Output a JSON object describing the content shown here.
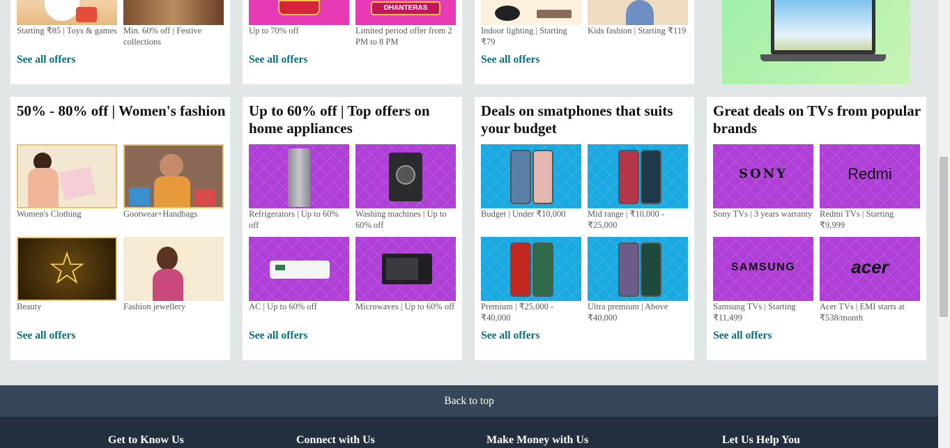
{
  "top_row": {
    "card1": {
      "tiles": [
        {
          "caption": "Starting ₹85 | Toys & games"
        },
        {
          "caption": "Min. 60% off | Festive collections"
        }
      ],
      "see_all": "See all offers"
    },
    "card2": {
      "tiles": [
        {
          "caption": "Up to 70% off"
        },
        {
          "caption": "Limited period offer from 2 PM to 8 PM",
          "banner_text": "DHANTERAS"
        }
      ],
      "see_all": "See all offers"
    },
    "card3": {
      "tiles": [
        {
          "caption": "Indoor lighting | Starting ₹79"
        },
        {
          "caption": "Kids fashion | Starting ₹119"
        }
      ],
      "see_all": "See all offers"
    }
  },
  "cards": [
    {
      "title": "50% - 80% off | Women's fashion",
      "tiles": [
        {
          "caption": "Women's Clothing"
        },
        {
          "caption": "Gootwear+Handbags"
        },
        {
          "caption": "Beauty"
        },
        {
          "caption": "Fashion jewellery"
        }
      ],
      "see_all": "See all offers"
    },
    {
      "title": "Up to 60% off | Top offers on home appliances",
      "tiles": [
        {
          "caption": "Refrigerators | Up to 60% off"
        },
        {
          "caption": "Washing machines | Up to 60% off"
        },
        {
          "caption": "AC | Up to 60% off"
        },
        {
          "caption": "Microwaves | Up to 60% off"
        }
      ],
      "see_all": "See all offers"
    },
    {
      "title": "Deals on smatphones that suits your budget",
      "tiles": [
        {
          "caption": "Budget | Under ₹10,000"
        },
        {
          "caption": "Mid range | ₹10,000 - ₹25,000"
        },
        {
          "caption": "Premium | ₹25,000 - ₹40,000"
        },
        {
          "caption": "Ultra premium | Above ₹40,000"
        }
      ],
      "see_all": "See all offers"
    },
    {
      "title": "Great deals on TVs from popular brands",
      "tiles": [
        {
          "caption": "Sony TVs | 3 years warranty",
          "brand": "SONY"
        },
        {
          "caption": "Redmi TVs | Starting ₹9,999",
          "brand": "Redmi"
        },
        {
          "caption": "Samsung TVs | Starting ₹11,499",
          "brand": "SAMSUNG"
        },
        {
          "caption": "Acer TVs | EMI starts at ₹538/month",
          "brand": "acer"
        }
      ],
      "see_all": "See all offers"
    }
  ],
  "back_to_top": "Back to top",
  "footer": {
    "columns": [
      "Get to Know Us",
      "Connect with Us",
      "Make Money with Us",
      "Let Us Help You"
    ]
  },
  "colors": {
    "link": "#007185",
    "back_to_top_bg": "#37475a",
    "footer_bg": "#232f3e",
    "tile_purple": "#b03fd8",
    "tile_cyan": "#1aa9e0"
  }
}
